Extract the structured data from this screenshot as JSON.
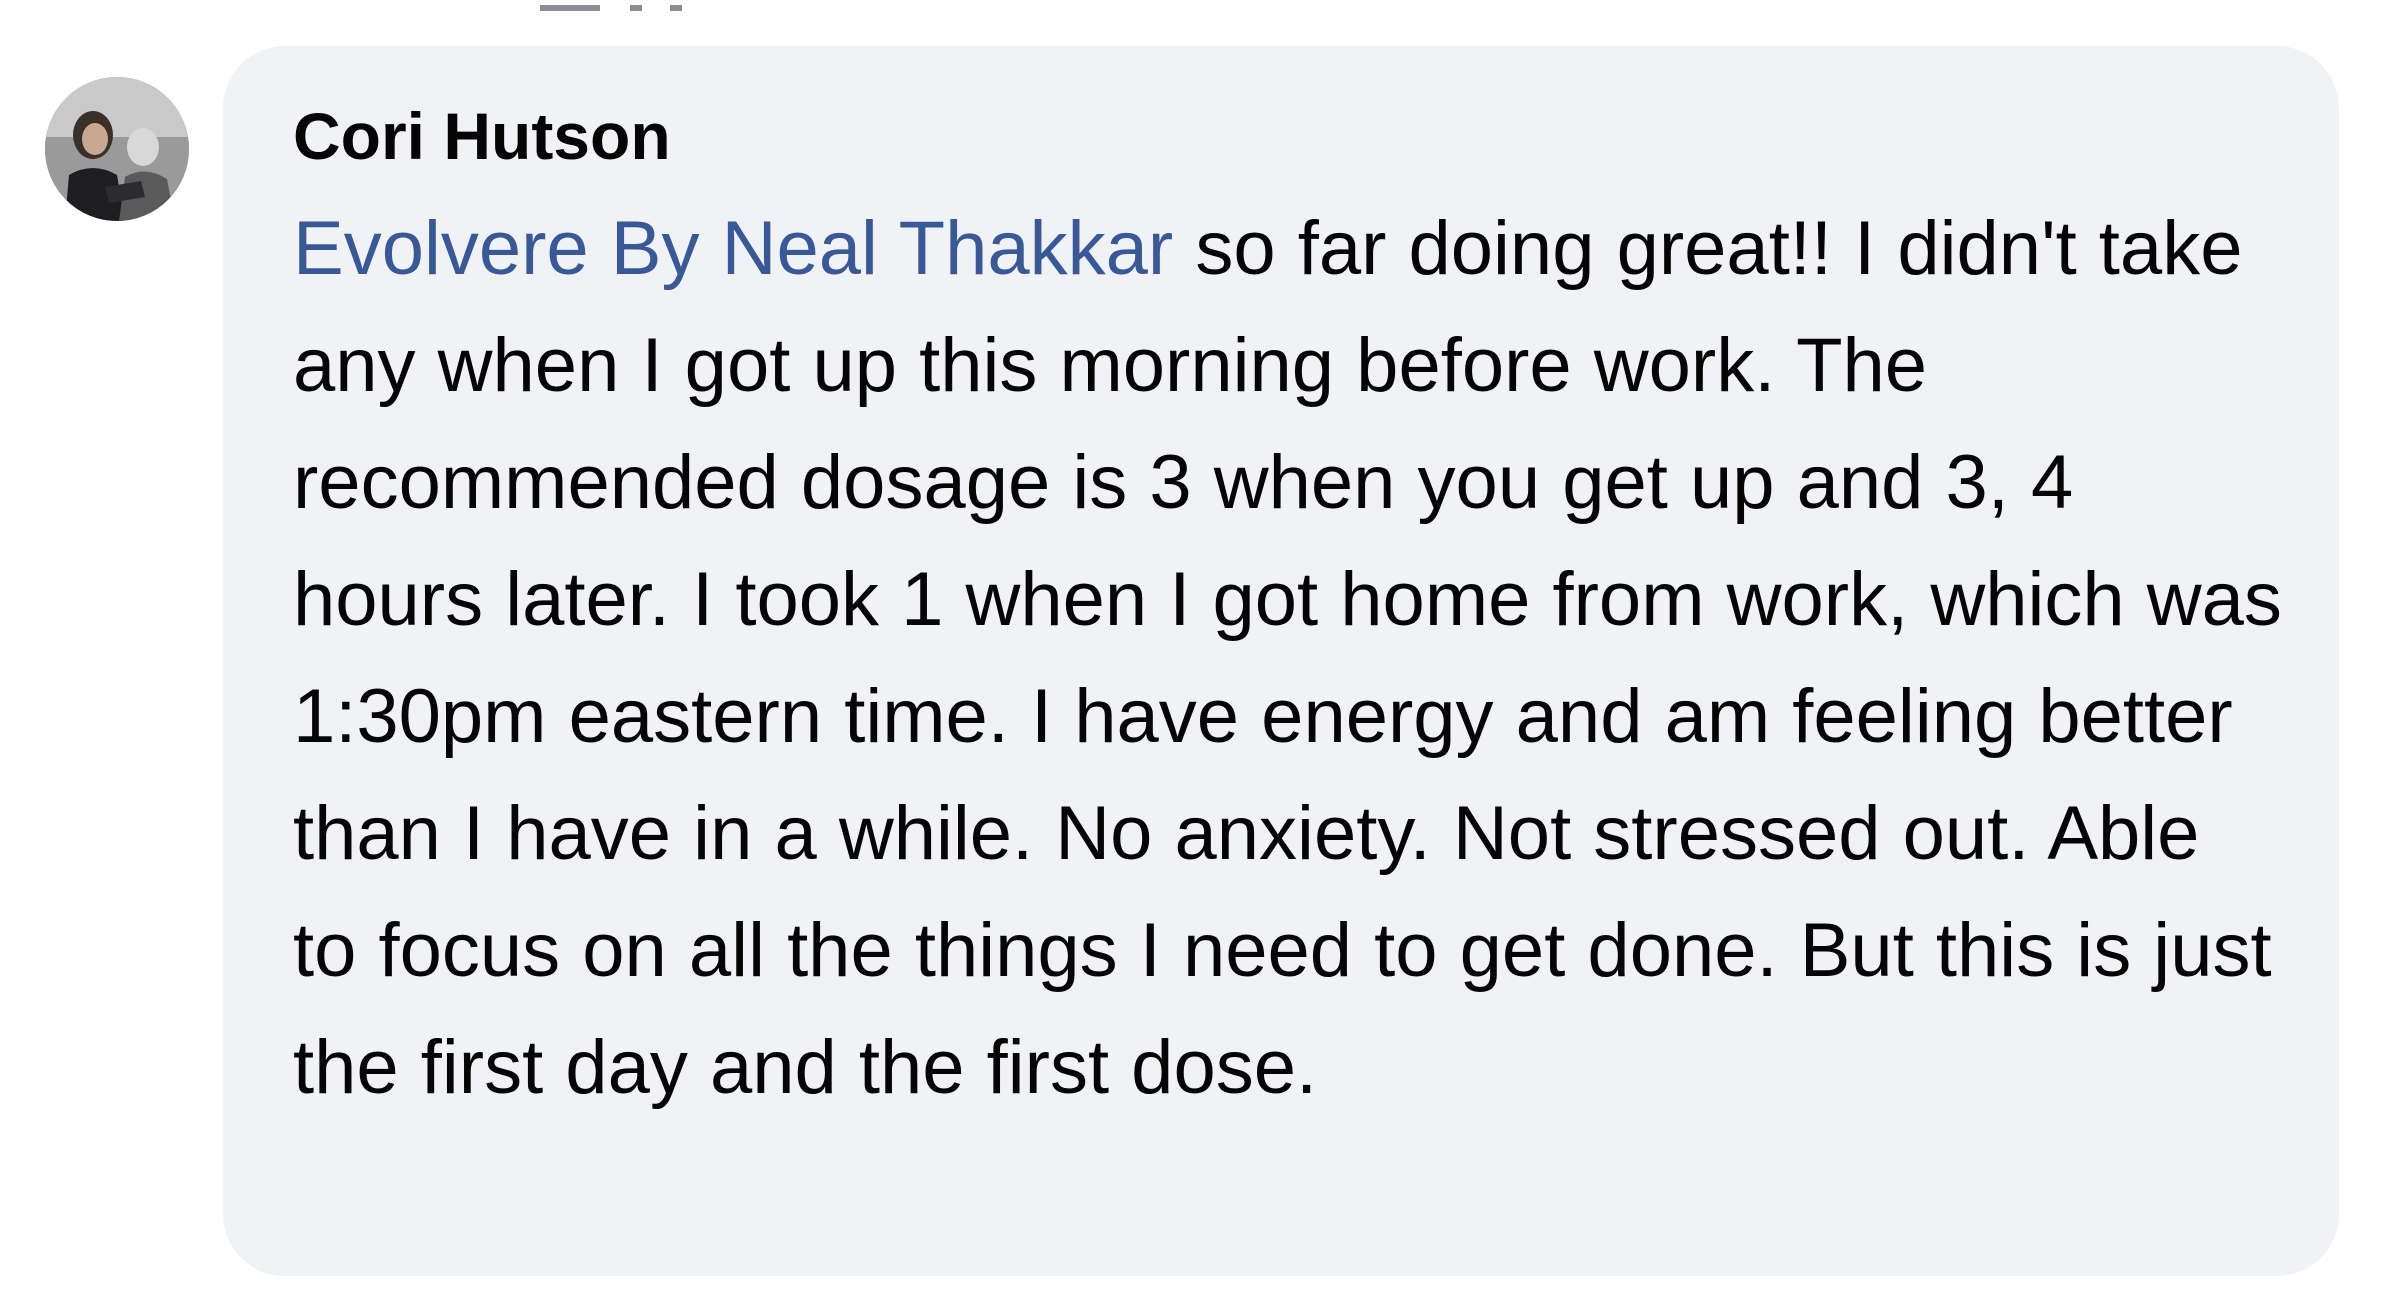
{
  "comment": {
    "author": "Cori Hutson",
    "mention": "Evolvere By Neal Thakkar",
    "body": " so far doing great!! I didn't take any when I got up this morning before work. The recommended dosage is 3 when you get up and 3, 4 hours later. I took 1 when I got home from work, which was 1:30pm eastern time. I have energy and am feeling better than I have in a while. No anxiety. Not stressed out. Able to focus on all the things I need to get done. But this is just the first day and the first dose."
  },
  "colors": {
    "bubble_background": "#f0f2f5",
    "text": "#050505",
    "mention_link": "#385898"
  },
  "icons": {
    "avatar": "user-profile-photo"
  }
}
